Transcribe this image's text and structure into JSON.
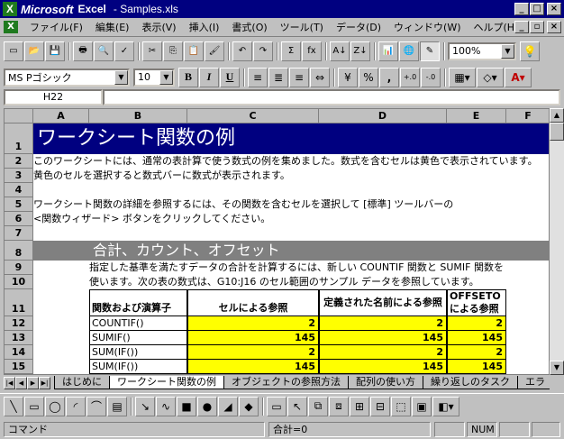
{
  "window": {
    "brand": "Microsoft",
    "app": "Excel",
    "doc": "- Samples.xls",
    "controls": {
      "min": "_",
      "max": "□",
      "close": "×"
    }
  },
  "menu": [
    "ファイル(F)",
    "編集(E)",
    "表示(V)",
    "挿入(I)",
    "書式(O)",
    "ツール(T)",
    "データ(D)",
    "ウィンドウ(W)",
    "ヘルプ(H)"
  ],
  "standard_toolbar": {
    "buttons": [
      {
        "name": "new-icon",
        "glyph": "▭"
      },
      {
        "name": "open-icon",
        "glyph": "📂"
      },
      {
        "name": "save-icon",
        "glyph": "💾"
      },
      {
        "name": "print-icon",
        "glyph": "🖶"
      },
      {
        "name": "print-preview-icon",
        "glyph": "🔍"
      },
      {
        "name": "spelling-icon",
        "glyph": "✓"
      },
      {
        "name": "cut-icon",
        "glyph": "✂"
      },
      {
        "name": "copy-icon",
        "glyph": "⎘"
      },
      {
        "name": "paste-icon",
        "glyph": "📋"
      },
      {
        "name": "format-painter-icon",
        "glyph": "🖌"
      },
      {
        "name": "undo-icon",
        "glyph": "↶"
      },
      {
        "name": "redo-icon",
        "glyph": "↷"
      },
      {
        "name": "autosum-icon",
        "glyph": "Σ"
      },
      {
        "name": "function-wizard-icon",
        "glyph": "fx"
      },
      {
        "name": "sort-ascending-icon",
        "glyph": "A↓"
      },
      {
        "name": "sort-descending-icon",
        "glyph": "Z↓"
      },
      {
        "name": "chart-wizard-icon",
        "glyph": "📊"
      },
      {
        "name": "map-icon",
        "glyph": "🌐"
      },
      {
        "name": "drawing-icon",
        "glyph": "✎"
      }
    ],
    "zoom": "100%",
    "help_glyph": "💡"
  },
  "format_toolbar": {
    "font": "MS Pゴシック",
    "size": "10",
    "bold": "B",
    "italic": "I",
    "underline": "U",
    "currency": "¥",
    "percent": "%",
    "comma": ",",
    "inc_decimal": "+.0",
    "dec_decimal": "-.0"
  },
  "namebox": "H22",
  "columns": [
    "A",
    "B",
    "C",
    "D",
    "E",
    "F"
  ],
  "rows": [
    "1",
    "2",
    "3",
    "4",
    "5",
    "6",
    "7",
    "8",
    "9",
    "10",
    "11",
    "12",
    "13",
    "14",
    "15"
  ],
  "cells": {
    "title": "ワークシート関数の例",
    "r2": "このワークシートには、通常の表計算で使う数式の例を集めました。数式を含むセルは黄色で表示されています。",
    "r3": "黄色のセルを選択すると数式バーに数式が表示されます。",
    "r5": "ワークシート関数の詳細を参照するには、その関数を含むセルを選択して [標準] ツールバーの",
    "r6": "<関数ウィザード> ボタンをクリックしてください。",
    "r8": "合計、カウント、オフセット",
    "r9": "指定した基準を満たすデータの合計を計算するには、新しい COUNTIF 関数と SUMIF 関数を",
    "r10": "使います。次の表の数式は、G10:J16 のセル範囲のサンプル データを参照しています。",
    "table_headers": [
      "関数および演算子",
      "セルによる参照",
      "定義された名前による参照",
      "OFFSETO による参照"
    ],
    "table_rows": [
      {
        "label": "COUNTIF()",
        "c": "2",
        "d": "2",
        "e": "2"
      },
      {
        "label": "SUMIF()",
        "c": "145",
        "d": "145",
        "e": "145"
      },
      {
        "label": "SUM(IF())",
        "c": "2",
        "d": "2",
        "e": "2"
      },
      {
        "label": "SUM(IF())",
        "c": "145",
        "d": "145",
        "e": "145"
      }
    ]
  },
  "sheet_tabs": [
    "はじめに",
    "ワークシート関数の例",
    "オブジェクトの参照方法",
    "配列の使い方",
    "繰り返しのタスク",
    "エラ"
  ],
  "status": {
    "mode": "コマンド",
    "sum": "合計=0",
    "num": "NUM"
  },
  "colors": {
    "title_bg": "#000080",
    "section_bg": "#808080",
    "formula_cell": "#ffff00"
  }
}
